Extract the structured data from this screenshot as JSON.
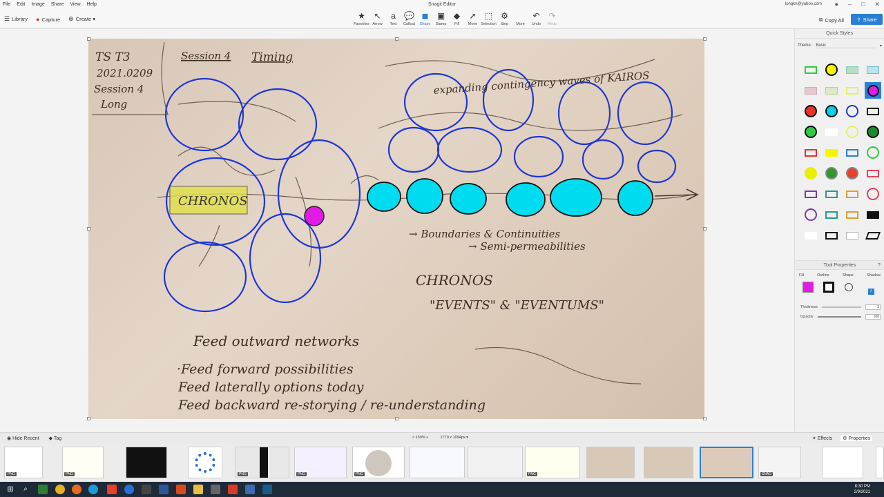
{
  "app": {
    "title": "Snagit Editor",
    "menus": [
      "File",
      "Edit",
      "Image",
      "Share",
      "View",
      "Help"
    ],
    "account": "longkn@yahoo.com"
  },
  "toolbar": {
    "left": {
      "library": "Library",
      "capture": "Capture",
      "create": "Create"
    },
    "tools": [
      {
        "label": "Favorites",
        "icon": "star-icon"
      },
      {
        "label": "Arrow",
        "icon": "arrow-icon"
      },
      {
        "label": "Text",
        "icon": "text-icon"
      },
      {
        "label": "Callout",
        "icon": "callout-icon"
      },
      {
        "label": "Shape",
        "icon": "shape-icon"
      },
      {
        "label": "Stamp",
        "icon": "stamp-icon"
      },
      {
        "label": "Fill",
        "icon": "fill-icon"
      },
      {
        "label": "Move",
        "icon": "move-icon"
      },
      {
        "label": "Selection",
        "icon": "selection-icon"
      },
      {
        "label": "Step",
        "icon": "step-icon"
      },
      {
        "label": "More",
        "icon": "more-icon"
      },
      {
        "label": "Undo",
        "icon": "undo-icon"
      },
      {
        "label": "Redo",
        "icon": "redo-icon"
      }
    ],
    "copy_all": "Copy All",
    "share": "Share"
  },
  "canvas": {
    "note_lines": [
      "TS T3",
      "2021.0209",
      "Session 4",
      "Long"
    ],
    "heading_session": "Session 4",
    "heading_timing": "Timing",
    "top_right": "expanding contingency waves of KAIROS",
    "box_label": "CHRONOS",
    "line1": "→ Boundaries & Continuities",
    "line2": "→ Semi-permeabilities",
    "chronos": "CHRONOS",
    "events": "\"EVENTS\" & \"EVENTUMS\"",
    "feed_title": "Feed outward networks",
    "feed1": "·Feed forward  possibilities",
    "feed2": "Feed laterally  options today",
    "feed3": "Feed backward  re-storying / re-understanding"
  },
  "quick_styles": {
    "title": "Quick Styles",
    "theme_label": "Theme:",
    "theme_value": "Basic"
  },
  "tool_properties": {
    "title": "Tool Properties",
    "fill": "Fill",
    "outline": "Outline",
    "shape": "Shape",
    "shadow": "Shadow",
    "thickness": "Thickness",
    "thickness_value": "3",
    "opacity": "Opacity",
    "opacity_value": "100",
    "fill_color": "#e21ae6"
  },
  "tray": {
    "hide_recent": "Hide Recent",
    "tag": "Tag",
    "zoom": "150%",
    "size": "1779 x 1094px",
    "effects": "Effects",
    "properties": "Properties",
    "badge_png": "PNG",
    "badge_snag": "SNAG"
  },
  "clock": {
    "time": "8:30 PM",
    "date": "2/9/2021"
  }
}
